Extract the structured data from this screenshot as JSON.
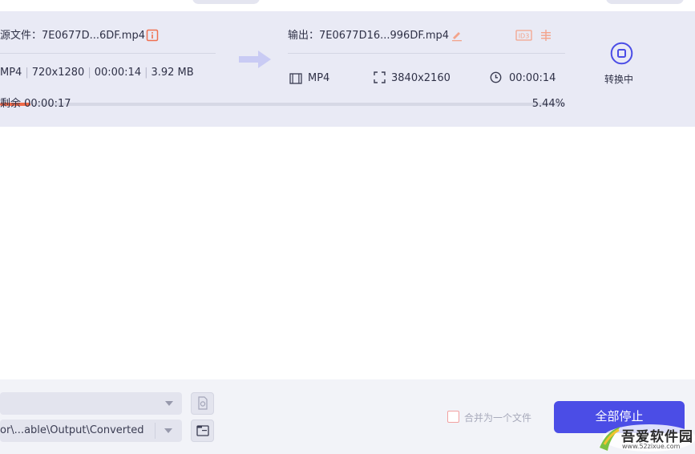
{
  "task": {
    "source_label": "源文件：7E0677D...6DF.mp4",
    "source_format": "MP4",
    "source_resolution": "720x1280",
    "source_duration": "00:00:14",
    "source_size": "3.92 MB",
    "output_label": "输出：7E0677D16...996DF.mp4",
    "output_format": "MP4",
    "output_resolution": "3840x2160",
    "output_duration": "00:00:14",
    "id3_tag": "ID3",
    "status_label": "转换中",
    "remaining_label": "剩余 00:00:17",
    "progress_text": "5.44%",
    "progress_fraction": 0.0544
  },
  "bottom": {
    "output_path": "or\\...able\\Output\\Converted",
    "merge_label": "合并为一个文件",
    "stop_all_label": "全部停止"
  },
  "watermark": {
    "brand": "吾爱软件园",
    "url": "www.52zixue.com"
  },
  "colors": {
    "accent": "#4b4de6",
    "progress": "#f06a49",
    "card_bg": "#e9eaf5",
    "icon_orange": "#f07050"
  }
}
